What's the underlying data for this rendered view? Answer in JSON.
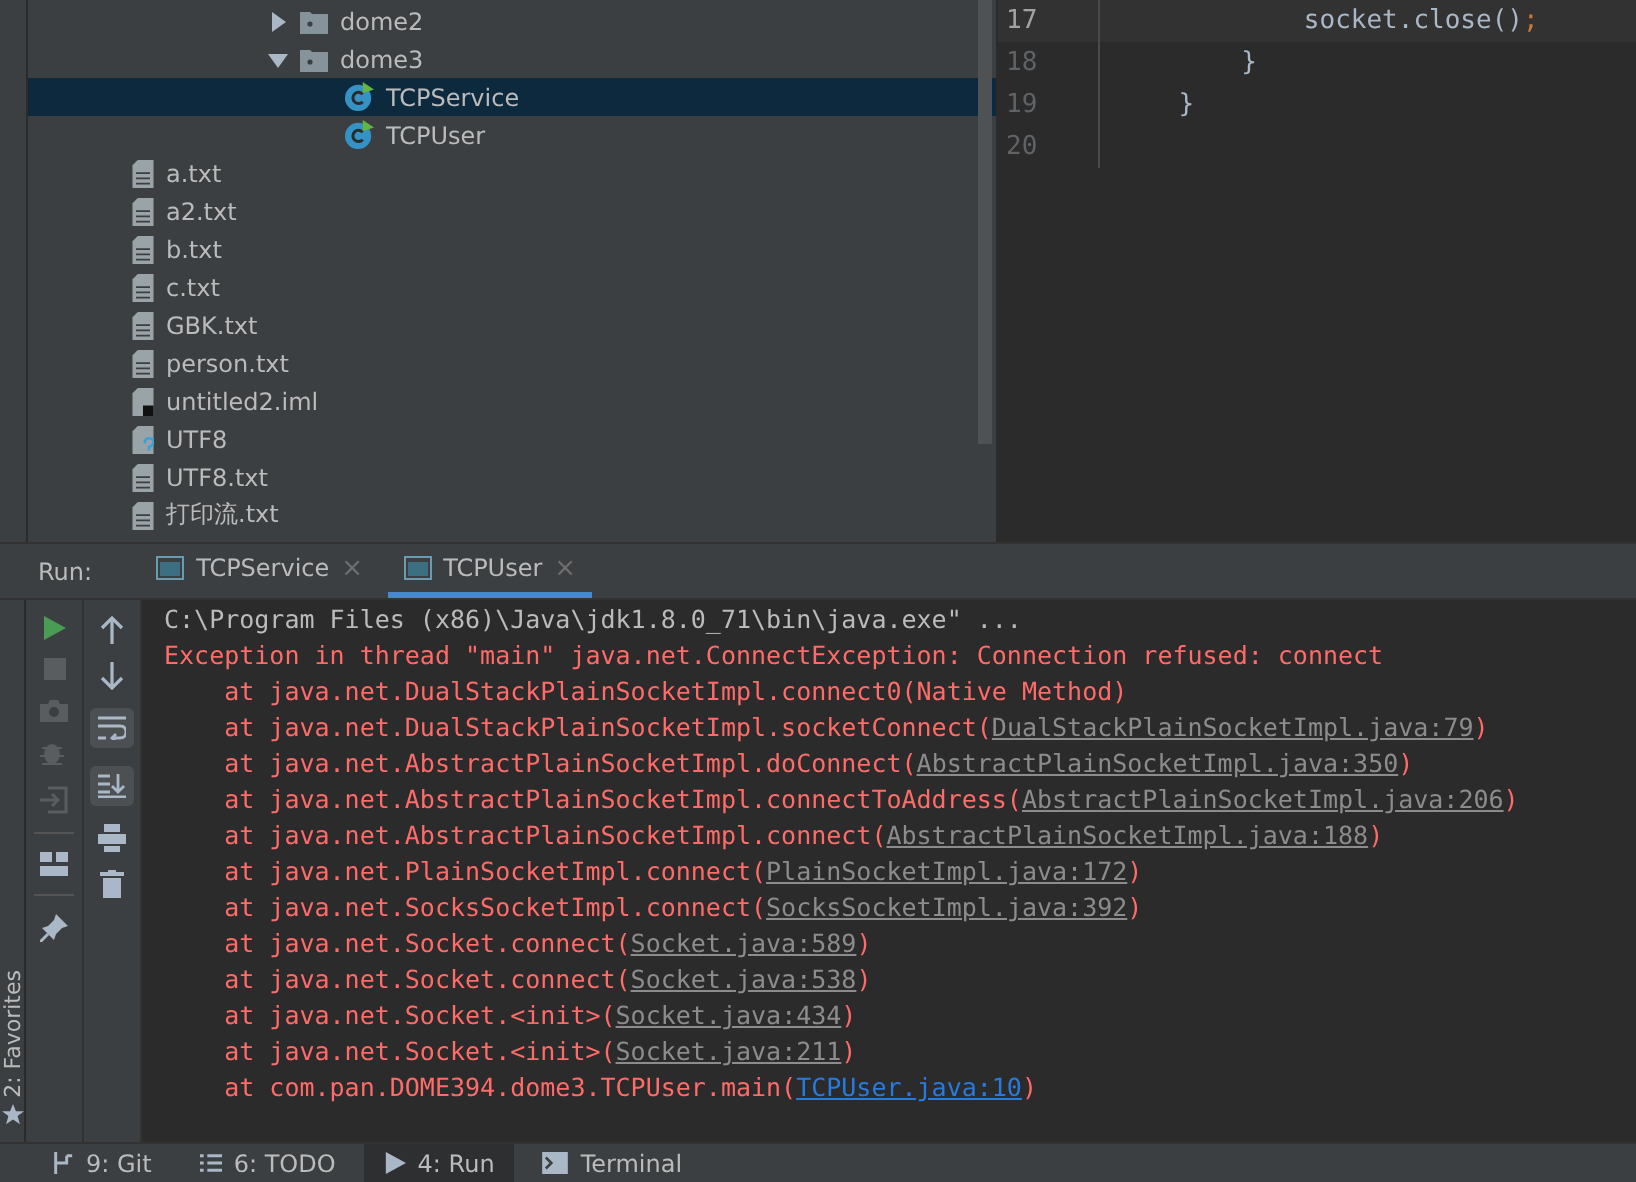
{
  "project_tree": {
    "items": [
      {
        "label": "dome2",
        "kind": "folder",
        "expanded": false,
        "selected": false
      },
      {
        "label": "dome3",
        "kind": "folder",
        "expanded": true,
        "selected": false,
        "children": [
          {
            "label": "TCPService",
            "kind": "class",
            "selected": true
          },
          {
            "label": "TCPUser",
            "kind": "class",
            "selected": false
          }
        ]
      }
    ],
    "files": [
      {
        "label": "a.txt",
        "kind": "text"
      },
      {
        "label": "a2.txt",
        "kind": "text"
      },
      {
        "label": "b.txt",
        "kind": "text"
      },
      {
        "label": "c.txt",
        "kind": "text"
      },
      {
        "label": "GBK.txt",
        "kind": "text"
      },
      {
        "label": "person.txt",
        "kind": "text"
      },
      {
        "label": "untitled2.iml",
        "kind": "module"
      },
      {
        "label": "UTF8",
        "kind": "unknown"
      },
      {
        "label": "UTF8.txt",
        "kind": "text"
      },
      {
        "label": "打印流.txt",
        "kind": "text"
      }
    ]
  },
  "editor": {
    "lines": [
      {
        "number": "17",
        "code": "            socket.close()",
        "punct": ";",
        "current": true
      },
      {
        "number": "18",
        "code": "        }",
        "current": false
      },
      {
        "number": "19",
        "code": "    }",
        "current": false
      },
      {
        "number": "20",
        "current": false
      }
    ]
  },
  "run_panel": {
    "label": "Run:",
    "tabs": [
      {
        "label": "TCPService",
        "close": "×",
        "selected": false
      },
      {
        "label": "TCPUser",
        "close": "×",
        "selected": true
      }
    ],
    "console": [
      {
        "kind": "command",
        "text": "C:\\Program Files (x86)\\Java\\jdk1.8.0_71\\bin\\java.exe\" ..."
      },
      {
        "kind": "error",
        "text": "Exception in thread \"main\" java.net.ConnectException: Connection refused: connect"
      },
      {
        "kind": "frame",
        "text": "    at java.net.DualStackPlainSocketImpl.connect0(Native Method)"
      },
      {
        "kind": "frame",
        "text": "    at java.net.DualStackPlainSocketImpl.socketConnect(",
        "link": "DualStackPlainSocketImpl.java:79",
        "end": ")"
      },
      {
        "kind": "frame",
        "text": "    at java.net.AbstractPlainSocketImpl.doConnect(",
        "link": "AbstractPlainSocketImpl.java:350",
        "end": ")"
      },
      {
        "kind": "frame",
        "text": "    at java.net.AbstractPlainSocketImpl.connectToAddress(",
        "link": "AbstractPlainSocketImpl.java:206",
        "end": ")"
      },
      {
        "kind": "frame",
        "text": "    at java.net.AbstractPlainSocketImpl.connect(",
        "link": "AbstractPlainSocketImpl.java:188",
        "end": ")"
      },
      {
        "kind": "frame",
        "text": "    at java.net.PlainSocketImpl.connect(",
        "link": "PlainSocketImpl.java:172",
        "end": ")"
      },
      {
        "kind": "frame",
        "text": "    at java.net.SocksSocketImpl.connect(",
        "link": "SocksSocketImpl.java:392",
        "end": ")"
      },
      {
        "kind": "frame",
        "text": "    at java.net.Socket.connect(",
        "link": "Socket.java:589",
        "end": ")"
      },
      {
        "kind": "frame",
        "text": "    at java.net.Socket.connect(",
        "link": "Socket.java:538",
        "end": ")"
      },
      {
        "kind": "frame",
        "text": "    at java.net.Socket.<init>(",
        "link": "Socket.java:434",
        "end": ")"
      },
      {
        "kind": "frame",
        "text": "    at java.net.Socket.<init>(",
        "link": "Socket.java:211",
        "end": ")"
      },
      {
        "kind": "user_frame",
        "text": "    at com.pan.DOME394.dome3.TCPUser.main(",
        "link": "TCPUser.java:10",
        "end": ")"
      }
    ]
  },
  "favorites": {
    "label": "2: Favorites"
  },
  "tool_tabs": [
    {
      "label": "9: Git",
      "kind": "git",
      "selected": false
    },
    {
      "label": "6: TODO",
      "kind": "todo",
      "selected": false
    },
    {
      "label": "4: Run",
      "kind": "run",
      "selected": true
    },
    {
      "label": "Terminal",
      "kind": "terminal",
      "selected": false
    }
  ]
}
